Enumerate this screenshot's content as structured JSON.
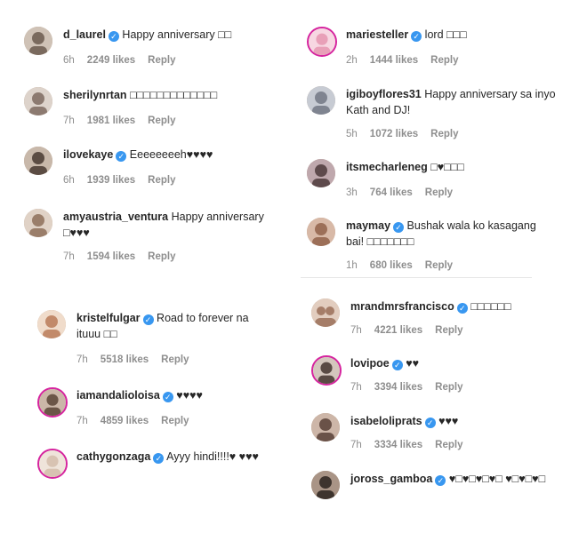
{
  "comments": [
    {
      "user": "d_laurel",
      "verified": true,
      "text": "Happy anniversary □□",
      "time": "6h",
      "likes": "2249 likes",
      "reply": "Reply",
      "color": "#7a6a5e"
    },
    {
      "user": "sherilynrtan",
      "verified": false,
      "text": "□□□□□□□□□□□□□",
      "time": "7h",
      "likes": "1981 likes",
      "reply": "Reply",
      "color": "#8c7a70"
    },
    {
      "user": "ilovekaye",
      "verified": true,
      "text": "Eeeeeeeeh♥♥♥♥",
      "time": "6h",
      "likes": "1939 likes",
      "reply": "Reply",
      "color": "#5b4c43"
    },
    {
      "user": "amyaustria_ventura",
      "verified": false,
      "text": "Happy anniversary □♥♥♥",
      "time": "7h",
      "likes": "1594 likes",
      "reply": "Reply",
      "color": "#9a7e6a"
    },
    {
      "user": "kristelfulgar",
      "verified": true,
      "text": "Road to forever na ituuu □□",
      "time": "7h",
      "likes": "5518 likes",
      "reply": "Reply",
      "color": "#c28a6a"
    },
    {
      "user": "iamandalioloisa",
      "verified": true,
      "text": "♥♥♥♥",
      "time": "7h",
      "likes": "4859 likes",
      "reply": "Reply",
      "color": "#6b5648"
    },
    {
      "user": "cathygonzaga",
      "verified": true,
      "text": "Ayyy hindi!!!!♥ ♥♥♥",
      "time": "",
      "likes": "",
      "reply": "",
      "color": "#d8c3b2"
    },
    {
      "user": "mariesteller",
      "verified": true,
      "text": "lord □□□",
      "time": "2h",
      "likes": "1444 likes",
      "reply": "Reply",
      "color": "#e8a0b8"
    },
    {
      "user": "igiboyflores31",
      "verified": false,
      "text": "Happy anniversary sa inyo Kath and DJ!",
      "time": "5h",
      "likes": "1072 likes",
      "reply": "Reply",
      "color": "#7f8490"
    },
    {
      "user": "itsmecharleneg",
      "verified": false,
      "text": "□♥□□□",
      "time": "3h",
      "likes": "764 likes",
      "reply": "Reply",
      "color": "#5e4a4c"
    },
    {
      "user": "maymay",
      "verified": true,
      "text": "Bushak wala ko kasagang bai! □□□□□□□",
      "time": "1h",
      "likes": "680 likes",
      "reply": "Reply",
      "color": "#9c6f58"
    },
    {
      "user": "mrandmrsfrancisco",
      "verified": true,
      "text": "□□□□□□",
      "time": "7h",
      "likes": "4221 likes",
      "reply": "Reply",
      "color": "#a57d68"
    },
    {
      "user": "lovipoe",
      "verified": true,
      "text": "♥♥",
      "time": "7h",
      "likes": "3394 likes",
      "reply": "Reply",
      "color": "#5a4a44"
    },
    {
      "user": "isabeloliprats",
      "verified": true,
      "text": "♥♥♥",
      "time": "7h",
      "likes": "3334 likes",
      "reply": "Reply",
      "color": "#6a5248"
    },
    {
      "user": "joross_gamboa",
      "verified": true,
      "text": "♥□♥□♥□♥□ ♥□♥□♥□",
      "time": "",
      "likes": "",
      "reply": "",
      "color": "#3e342e"
    }
  ]
}
